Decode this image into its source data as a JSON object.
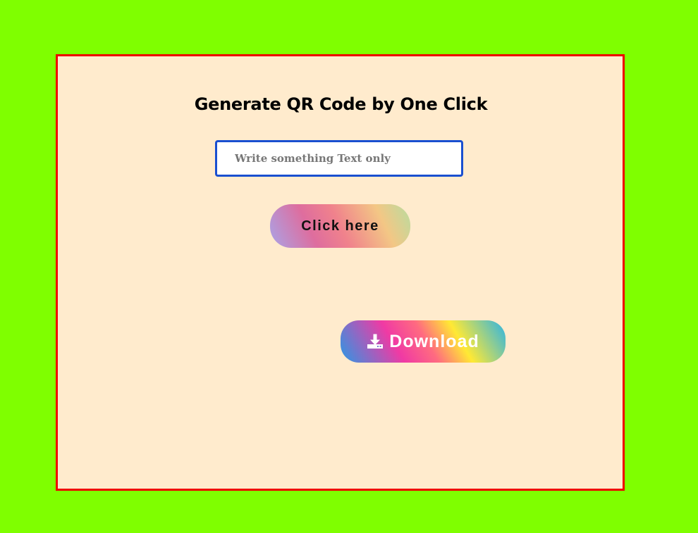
{
  "page": {
    "background_color": "#7fff00",
    "card_background_color": "#ffebcd",
    "card_border_color": "#ee0000"
  },
  "qr_form": {
    "title": "Generate QR Code by One Click",
    "text_input": {
      "value": "",
      "placeholder": "Write something Text only"
    },
    "generate_button_label": "Click here",
    "download_button": {
      "icon": "download-icon",
      "label": "Download"
    }
  }
}
